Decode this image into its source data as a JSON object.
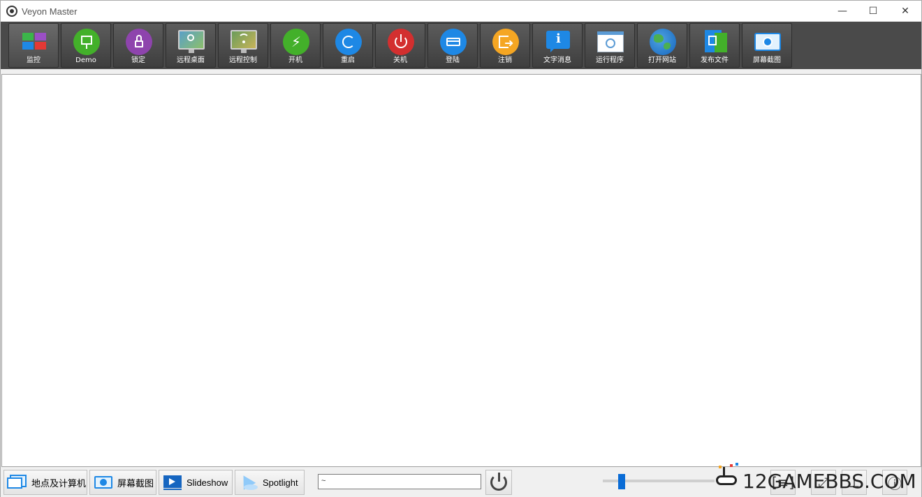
{
  "window": {
    "title": "Veyon Master",
    "minimize": "—",
    "maximize": "☐",
    "close": "✕"
  },
  "toolbar": [
    {
      "label": "监控",
      "icon": "monitoring-icon"
    },
    {
      "label": "Demo",
      "icon": "demo-icon"
    },
    {
      "label": "锁定",
      "icon": "lock-icon"
    },
    {
      "label": "远程桌面",
      "icon": "remote-view-icon"
    },
    {
      "label": "远程控制",
      "icon": "remote-control-icon"
    },
    {
      "label": "开机",
      "icon": "power-on-icon"
    },
    {
      "label": "重启",
      "icon": "reboot-icon"
    },
    {
      "label": "关机",
      "icon": "power-down-icon"
    },
    {
      "label": "登陆",
      "icon": "logon-icon"
    },
    {
      "label": "注销",
      "icon": "logout-icon"
    },
    {
      "label": "文字消息",
      "icon": "text-message-icon"
    },
    {
      "label": "运行程序",
      "icon": "run-program-icon"
    },
    {
      "label": "打开网站",
      "icon": "open-website-icon"
    },
    {
      "label": "发布文件",
      "icon": "file-transfer-icon"
    },
    {
      "label": "屏幕截图",
      "icon": "screenshot-icon"
    }
  ],
  "statusbar": {
    "locations_label": "地点及计算机",
    "screenshots_label": "屏幕截图",
    "slideshow_label": "Slideshow",
    "spotlight_label": "Spotlight",
    "filter_value": "~",
    "zoom_level": 0.17,
    "right_buttons": [
      "[≡]",
      "⤢",
      "⟂",
      "ⓘ"
    ]
  },
  "watermark": "12GAMEBBS.COM"
}
